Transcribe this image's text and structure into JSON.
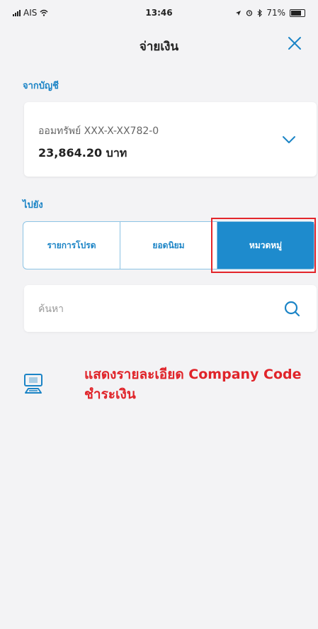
{
  "status_bar": {
    "carrier": "AIS",
    "time": "13:46",
    "battery": "71%"
  },
  "header": {
    "title": "จ่ายเงิน"
  },
  "from_account": {
    "section_label": "จากบัญชี",
    "account_name": "ออมทรัพย์ XXX-X-XX782-0",
    "balance": "23,864.20 บาท"
  },
  "to": {
    "section_label": "ไปยัง",
    "tabs": [
      {
        "label": "รายการโปรด",
        "active": false
      },
      {
        "label": "ยอดนิยม",
        "active": false
      },
      {
        "label": "หมวดหมู่",
        "active": true
      }
    ]
  },
  "search": {
    "placeholder": "ค้นหา",
    "value": ""
  },
  "annotation": {
    "text": "แสดงรายละเอียด Company Code ชำระเงิน"
  },
  "colors": {
    "accent": "#1e8bcd",
    "highlight": "#e3262b",
    "background": "#f3f3f5"
  }
}
